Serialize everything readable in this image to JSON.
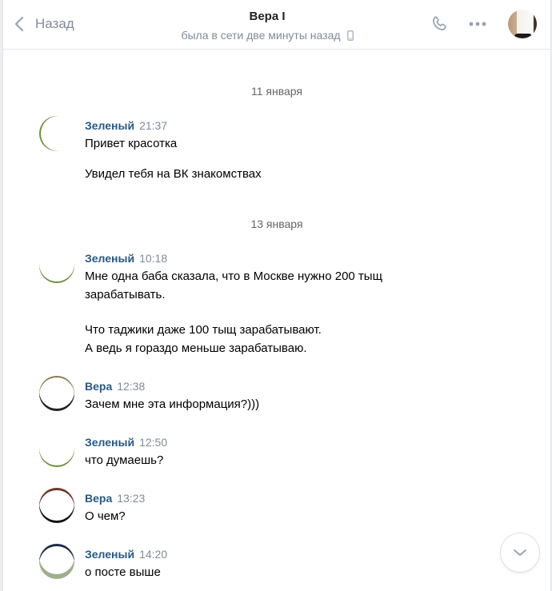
{
  "header": {
    "back_label": "Назад",
    "title": "Вера I",
    "status": "была в сети две минуты назад"
  },
  "icons": {
    "back": "chevron-left-icon",
    "mobile": "mobile-phone-icon",
    "call": "phone-icon",
    "more": "more-icon",
    "scroll_down": "chevron-down-icon"
  },
  "colors": {
    "author": "#2a5885",
    "muted": "#828a99",
    "background": "#edeef0"
  },
  "dates": [
    "11 января",
    "13 января"
  ],
  "messages": [
    {
      "author": "Зеленый",
      "time": "21:37",
      "lines": [
        "Привет красотка",
        "",
        "Увидел тебя на ВК знакомствах"
      ]
    },
    {
      "author": "Зеленый",
      "time": "10:18",
      "lines": [
        "Мне одна баба сказала, что в Москве нужно 200 тыщ",
        "зарабатывать.",
        "",
        "Что таджики даже 100 тыщ зарабатывают.",
        "А ведь я гораздо меньше зарабатываю."
      ]
    },
    {
      "author": "Вера",
      "time": "12:38",
      "lines": [
        "Зачем мне эта информация?)))"
      ]
    },
    {
      "author": "Зеленый",
      "time": "12:50",
      "lines": [
        "что думаешь?"
      ]
    },
    {
      "author": "Вера",
      "time": "13:23",
      "lines": [
        "О чем?"
      ]
    },
    {
      "author": "Зеленый",
      "time": "14:20",
      "lines": [
        "о посте выше"
      ]
    }
  ]
}
